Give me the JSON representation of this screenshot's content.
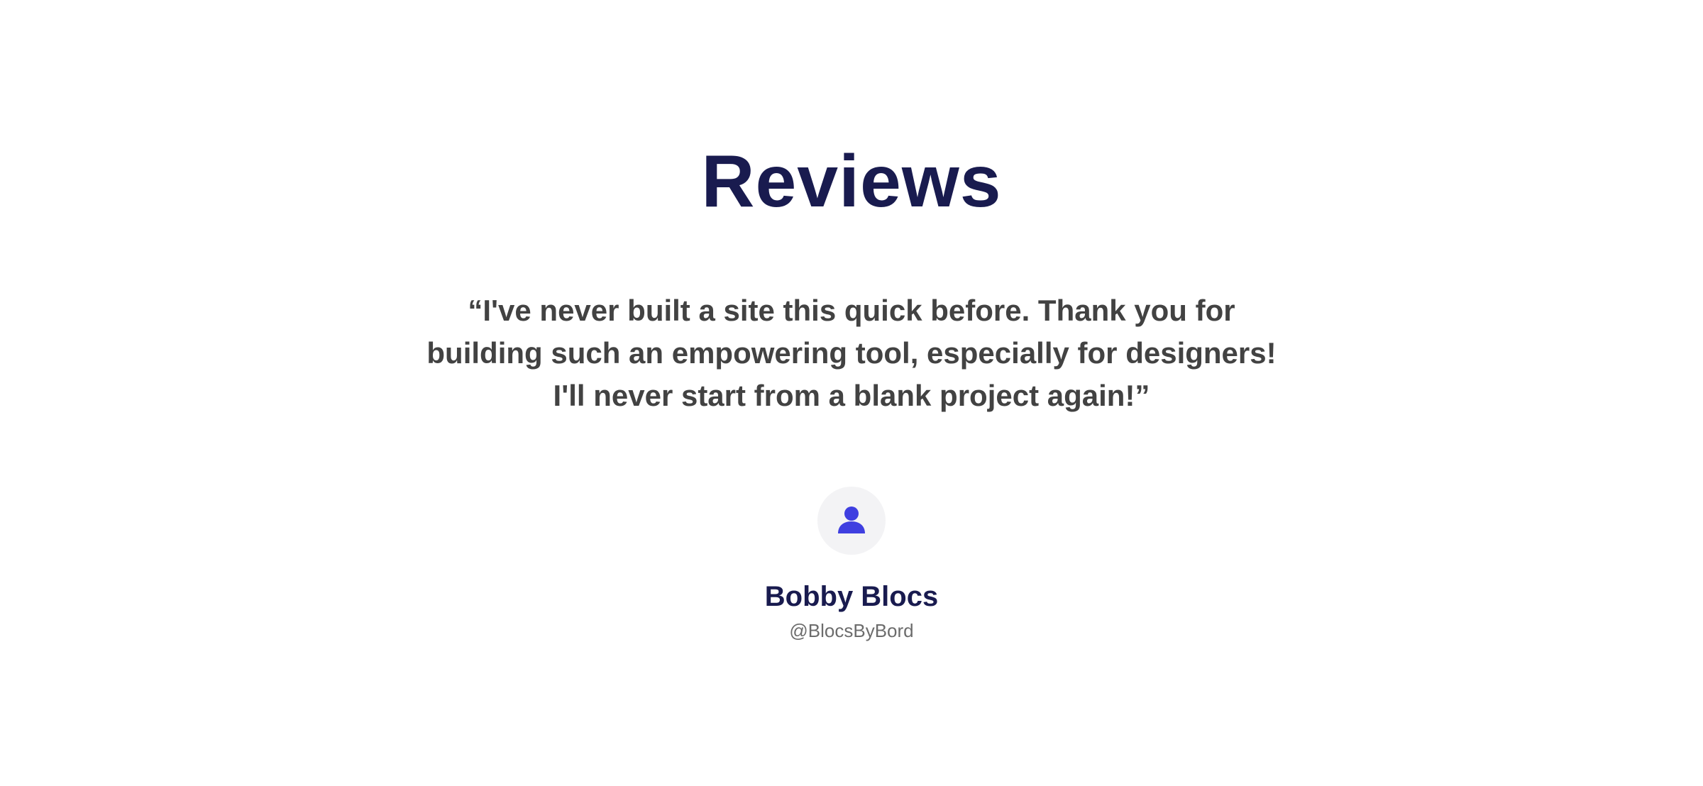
{
  "section": {
    "title": "Reviews"
  },
  "review": {
    "quote": "“I've never built a site this quick before. Thank you for building such an empowering tool, especially for designers! I'll never start from a blank project again!”",
    "author_name": "Bobby Blocs",
    "author_handle": "@BlocsByBord",
    "avatar_icon": "user-icon"
  },
  "colors": {
    "heading": "#191b4f",
    "body_text": "#424242",
    "muted_text": "#6c6c6c",
    "accent": "#3f3fe0",
    "avatar_bg": "#f3f3f5"
  }
}
